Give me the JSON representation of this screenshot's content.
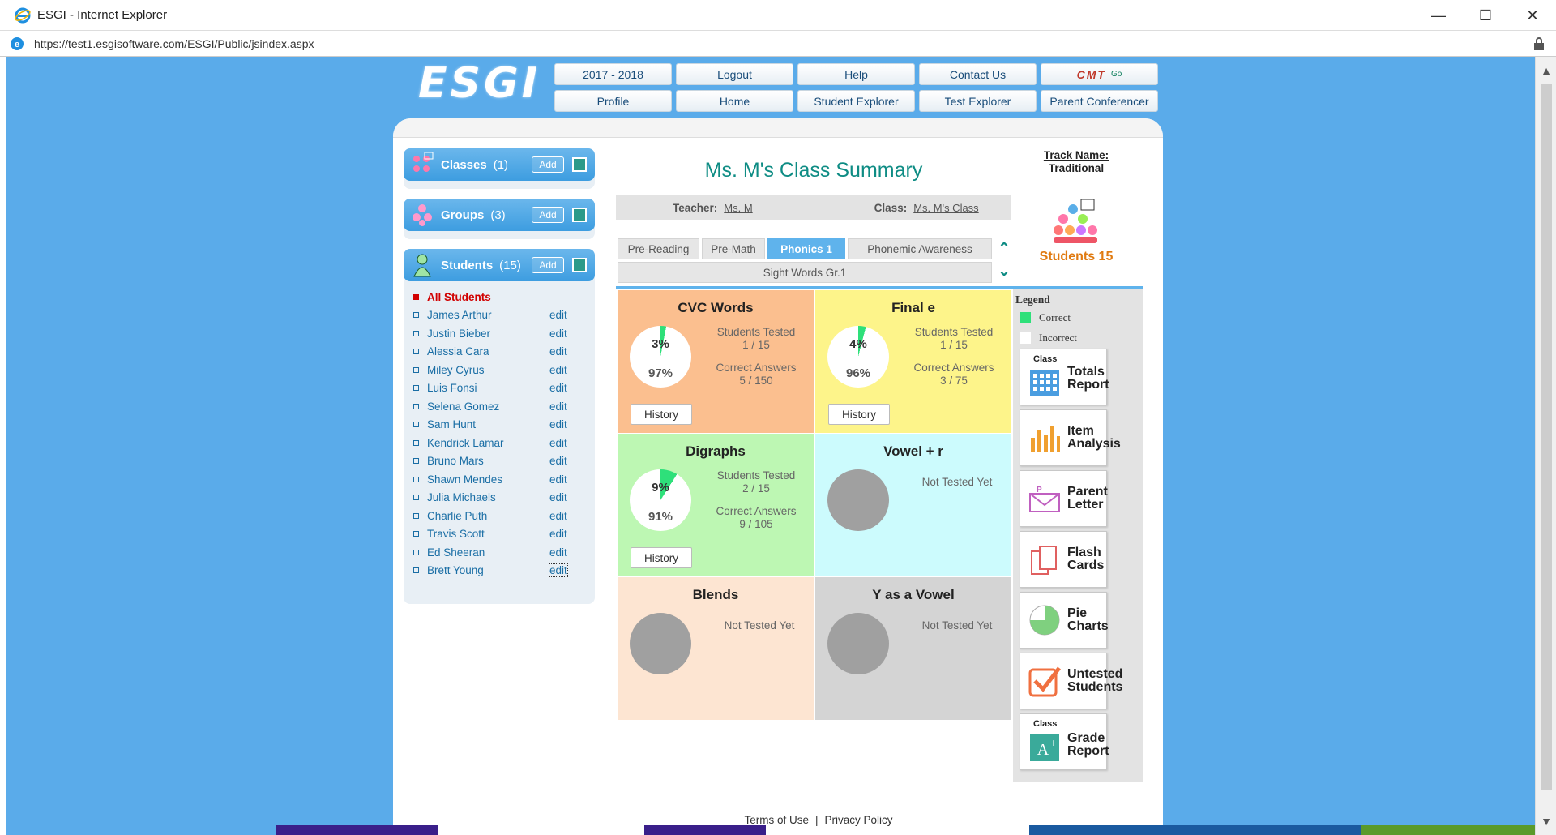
{
  "window": {
    "title": "ESGI - Internet Explorer",
    "url": "https://test1.esgisoftware.com/ESGI/Public/jsindex.aspx"
  },
  "logo": "ESGI",
  "nav": {
    "row1": [
      "2017 - 2018",
      "Logout",
      "Help",
      "Contact Us"
    ],
    "cmt": "CMT",
    "cmt_go": "Go",
    "row2": [
      "Profile",
      "Home",
      "Student Explorer",
      "Test Explorer",
      "Parent Conferencer"
    ]
  },
  "sidebar": {
    "classes": {
      "label": "Classes",
      "count": "(1)",
      "add": "Add"
    },
    "groups": {
      "label": "Groups",
      "count": "(3)",
      "add": "Add"
    },
    "students": {
      "label": "Students",
      "count": "(15)",
      "add": "Add"
    },
    "all_students": "All Students",
    "edit_label": "edit",
    "student_list": [
      "James Arthur",
      "Justin Bieber",
      "Alessia Cara",
      "Miley Cyrus",
      "Luis Fonsi",
      "Selena Gomez",
      "Sam Hunt",
      "Kendrick Lamar",
      "Bruno Mars",
      "Shawn Mendes",
      "Julia Michaels",
      "Charlie Puth",
      "Travis Scott",
      "Ed Sheeran",
      "Brett Young"
    ]
  },
  "summary": {
    "title": "Ms. M's Class Summary",
    "teacher_label": "Teacher:",
    "teacher": "Ms. M",
    "class_label": "Class:",
    "class_name": "Ms. M's Class",
    "tabs": [
      "Pre-Reading",
      "Pre-Math",
      "Phonics 1",
      "Phonemic Awareness"
    ],
    "active_tab": "Phonics 1",
    "subtab": "Sight Words Gr.1"
  },
  "tiles": [
    {
      "name": "CVC Words",
      "color": "#fbbf8f",
      "tested": true,
      "correct_pct": "3%",
      "incorrect_pct": "97%",
      "correct_frac": 0.03,
      "st_label": "Students Tested",
      "st_val": "1 / 15",
      "ca_label": "Correct Answers",
      "ca_val": "5 / 150",
      "history": "History"
    },
    {
      "name": "Final e",
      "color": "#fdf48a",
      "tested": true,
      "correct_pct": "4%",
      "incorrect_pct": "96%",
      "correct_frac": 0.04,
      "st_label": "Students Tested",
      "st_val": "1 / 15",
      "ca_label": "Correct Answers",
      "ca_val": "3 / 75",
      "history": "History"
    },
    {
      "name": "Digraphs",
      "color": "#bdf7b3",
      "tested": true,
      "correct_pct": "9%",
      "incorrect_pct": "91%",
      "correct_frac": 0.09,
      "st_label": "Students Tested",
      "st_val": "2 / 15",
      "ca_label": "Correct Answers",
      "ca_val": "9 / 105",
      "history": "History"
    },
    {
      "name": "Vowel + r",
      "color": "#ccfbfd",
      "tested": false,
      "not_tested": "Not Tested Yet"
    },
    {
      "name": "Blends",
      "color": "#fde5d2",
      "tested": false,
      "not_tested": "Not Tested Yet"
    },
    {
      "name": "Y as a Vowel",
      "color": "#d4d4d4",
      "tested": false,
      "not_tested": "Not Tested Yet"
    }
  ],
  "right": {
    "track_label": "Track Name:",
    "track": "Traditional",
    "students_count": "Students 15",
    "legend_title": "Legend",
    "legend_correct": "Correct",
    "legend_incorrect": "Incorrect",
    "correct_color": "#2ee07a",
    "class_label": "Class",
    "buttons": [
      {
        "icon": "calendar-grid-icon",
        "l1": "Totals",
        "l2": "Report",
        "class_tag": true
      },
      {
        "icon": "bar-chart-icon",
        "l1": "Item",
        "l2": "Analysis"
      },
      {
        "icon": "envelope-icon",
        "l1": "Parent",
        "l2": "Letter"
      },
      {
        "icon": "flash-cards-icon",
        "l1": "Flash",
        "l2": "Cards"
      },
      {
        "icon": "pie-chart-icon",
        "l1": "Pie",
        "l2": "Charts"
      },
      {
        "icon": "checkmark-icon",
        "l1": "Untested",
        "l2": "Students"
      },
      {
        "icon": "grade-a-plus-icon",
        "l1": "Grade",
        "l2": "Report",
        "class_tag": true
      }
    ]
  },
  "footer": {
    "terms": "Terms of Use",
    "sep": "|",
    "privacy": "Privacy Policy"
  }
}
